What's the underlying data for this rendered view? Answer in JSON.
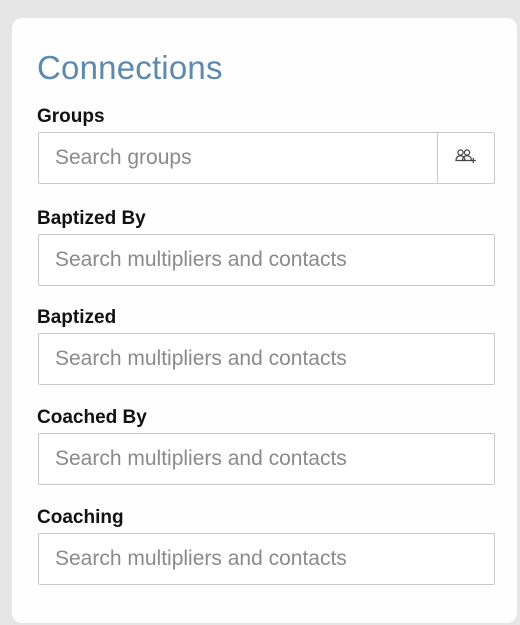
{
  "connections": {
    "title": "Connections",
    "fields": {
      "groups": {
        "label": "Groups",
        "placeholder": "Search groups",
        "addon_icon": "add-group-icon"
      },
      "baptized_by": {
        "label": "Baptized By",
        "placeholder": "Search multipliers and contacts"
      },
      "baptized": {
        "label": "Baptized",
        "placeholder": "Search multipliers and contacts"
      },
      "coached_by": {
        "label": "Coached By",
        "placeholder": "Search multipliers and contacts"
      },
      "coaching": {
        "label": "Coaching",
        "placeholder": "Search multipliers and contacts"
      }
    }
  },
  "colors": {
    "title": "#5d89ad",
    "page_background": "#e6e6e6",
    "card_background": "#fefefe",
    "input_border": "#c9c9c9"
  }
}
